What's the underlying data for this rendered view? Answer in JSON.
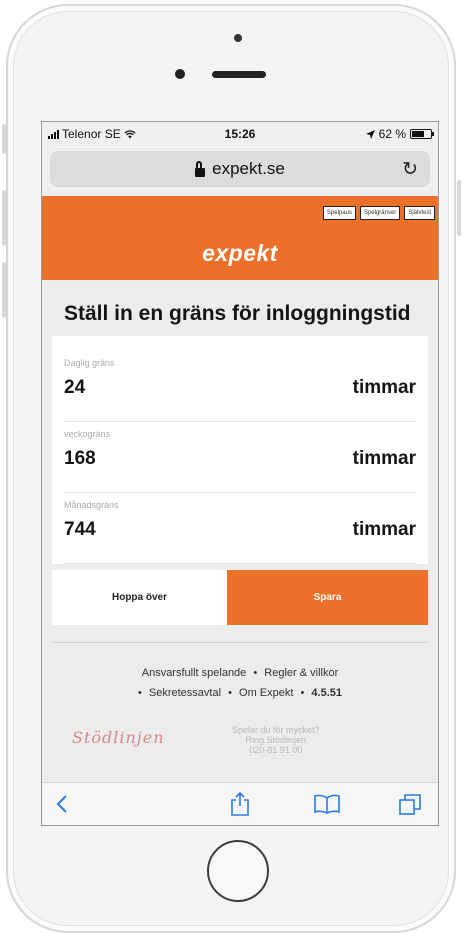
{
  "status_bar": {
    "carrier": "Telenor SE",
    "time": "15:26",
    "battery": "62 %"
  },
  "browser": {
    "url": "expekt.se"
  },
  "header": {
    "links": [
      "Spelpaus",
      "Spelgränser",
      "Självtest"
    ],
    "logo": "expekt"
  },
  "page": {
    "title": "Ställ in en gräns för inloggningstid"
  },
  "limits": [
    {
      "label": "Daglig gräns",
      "value": "24",
      "unit": "timmar"
    },
    {
      "label": "veckogräns",
      "value": "168",
      "unit": "timmar"
    },
    {
      "label": "Månadsgräns",
      "value": "744",
      "unit": "timmar"
    }
  ],
  "buttons": {
    "skip": "Hoppa över",
    "save": "Spara"
  },
  "footer": {
    "links": [
      "Ansvarsfullt spelande",
      "Regler & villkor",
      "Sekretessavtal",
      "Om Expekt"
    ],
    "version": "4.5.51",
    "helpline_logo": "Stödlinjen",
    "helpline_text": [
      "Spelar du för mycket?",
      "Ring Stödlinjen",
      "020-81 91 00"
    ]
  },
  "colors": {
    "accent": "#ec7029",
    "ios_blue": "#2a7ce6"
  },
  "toolbar_icons": [
    "back-icon",
    "share-icon",
    "bookmarks-icon",
    "tabs-icon"
  ]
}
